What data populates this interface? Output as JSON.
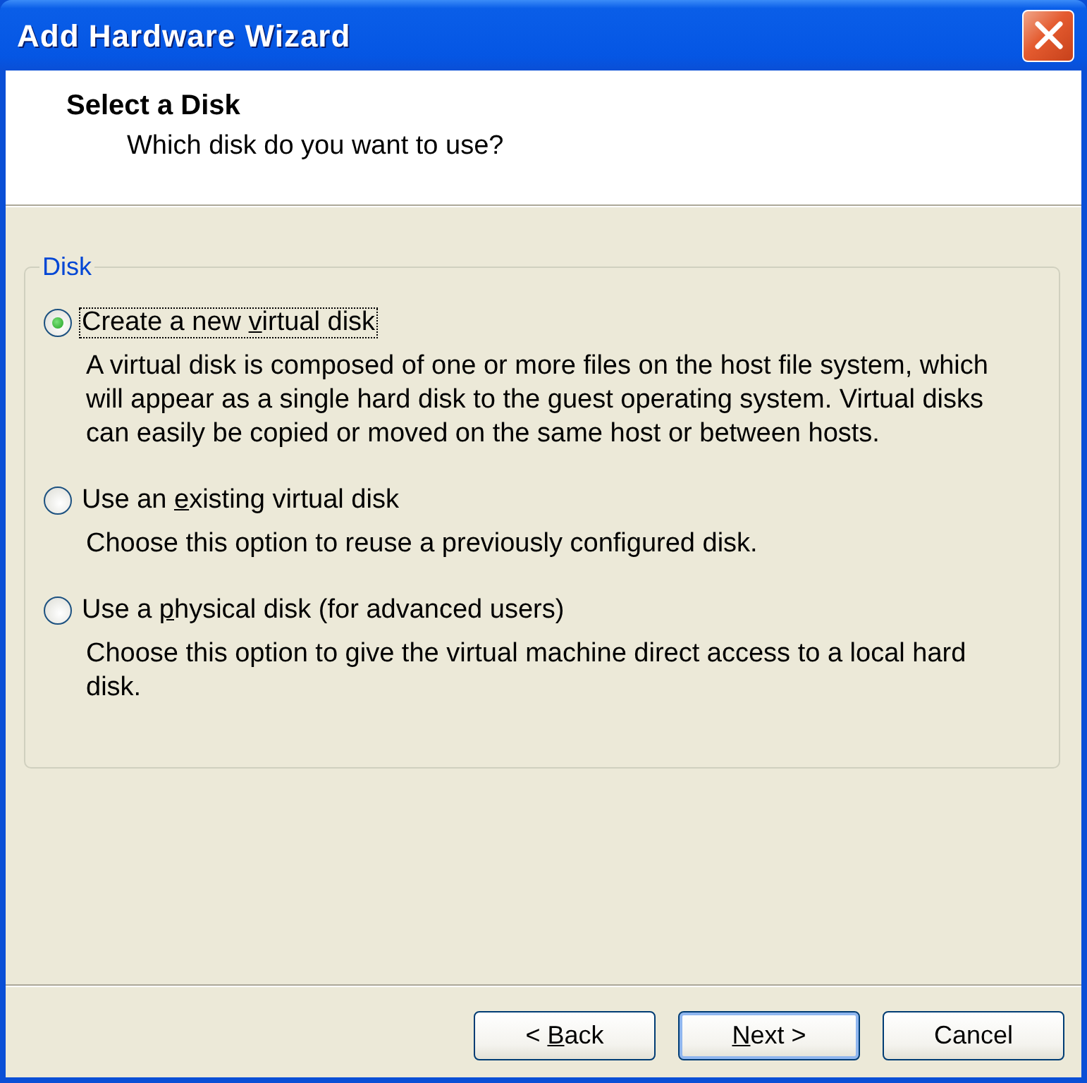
{
  "window": {
    "title": "Add Hardware Wizard"
  },
  "header": {
    "title": "Select a Disk",
    "subtitle": "Which disk do you want to use?"
  },
  "group": {
    "label": "Disk",
    "options": [
      {
        "label": [
          {
            "text": "Create a new "
          },
          {
            "text": "v",
            "underlined": true
          },
          {
            "text": "irtual disk"
          }
        ],
        "description": "A virtual disk is composed of one or more files on the host file system, which will appear as a single hard disk to the guest operating system. Virtual disks can easily be copied or moved on the same host or between hosts.",
        "selected": true,
        "focused": true
      },
      {
        "label": [
          {
            "text": "Use an "
          },
          {
            "text": "e",
            "underlined": true
          },
          {
            "text": "xisting virtual disk"
          }
        ],
        "description": "Choose this option to reuse a previously configured disk.",
        "selected": false,
        "focused": false
      },
      {
        "label": [
          {
            "text": "Use a "
          },
          {
            "text": "p",
            "underlined": true
          },
          {
            "text": "hysical disk (for advanced users)"
          }
        ],
        "description": "Choose this option to give the virtual machine direct access to a local hard disk.",
        "selected": false,
        "focused": false
      }
    ]
  },
  "buttons": [
    {
      "label": [
        {
          "text": "< "
        },
        {
          "text": "B",
          "underlined": true
        },
        {
          "text": "ack"
        }
      ],
      "default": false
    },
    {
      "label": [
        {
          "text": "N",
          "underlined": true
        },
        {
          "text": "ext >"
        }
      ],
      "default": true
    },
    {
      "label": [
        {
          "text": "Cancel"
        }
      ],
      "default": false
    }
  ]
}
